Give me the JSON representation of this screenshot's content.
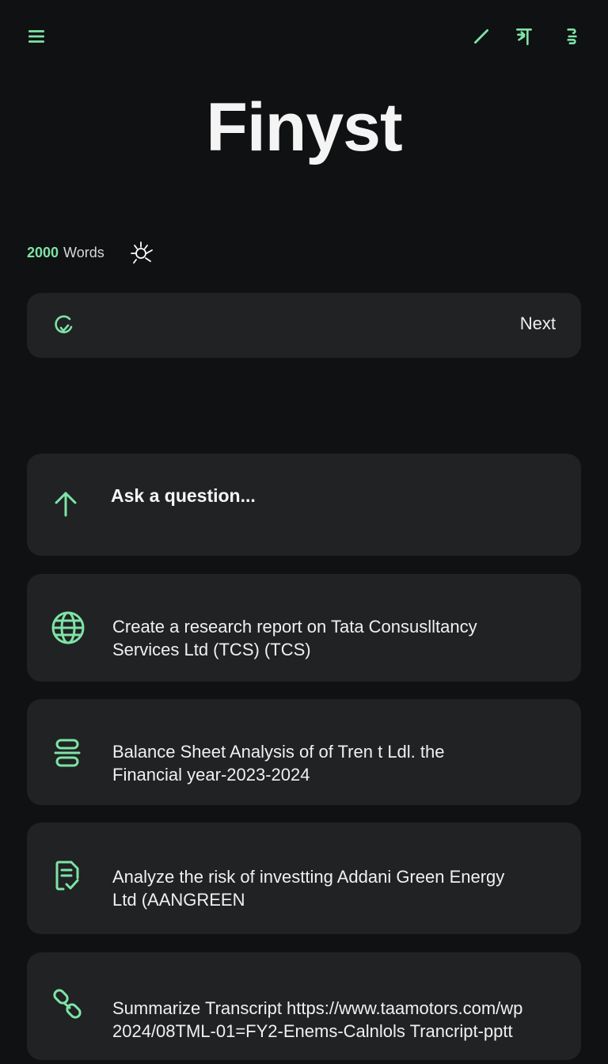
{
  "app": {
    "title": "Finyst",
    "accent_color": "#7ee3a6",
    "background_color": "#0f1112",
    "card_color": "#202223"
  },
  "toolbar": {
    "menu_icon": "hamburger-menu-icon",
    "edit_icon": "pencil-icon",
    "share_icon": "export-icon",
    "more_icon": "more-vertical-icon"
  },
  "meta": {
    "word_count": "2000",
    "word_label": "Words",
    "status_icon": "spark-icon"
  },
  "next_bar": {
    "icon": "refresh-icon",
    "label": "Next"
  },
  "ask": {
    "icon": "arrow-up-icon",
    "placeholder": "Ask a question..."
  },
  "prompts": [
    {
      "icon": "globe-icon",
      "line1": "Create a research report on Tata Consuslltancy",
      "line2": "Services Ltd (TCS) (TCS)"
    },
    {
      "icon": "ledger-icon",
      "line1": "Balance Sheet Analysis of of Tren t Ldl. the",
      "line2": "Financial year-2023-2024"
    },
    {
      "icon": "document-check-icon",
      "line1": "Analyze the risk of investting Addani Green Energy",
      "line2": "Ltd (AANGREEN"
    },
    {
      "icon": "link-icon",
      "line1": "Summarize Transcript https://www.taamotors.com/wp",
      "line2": "2024/08TML-01=FY2-Enems-Calnlols Trancript-pptt"
    }
  ]
}
